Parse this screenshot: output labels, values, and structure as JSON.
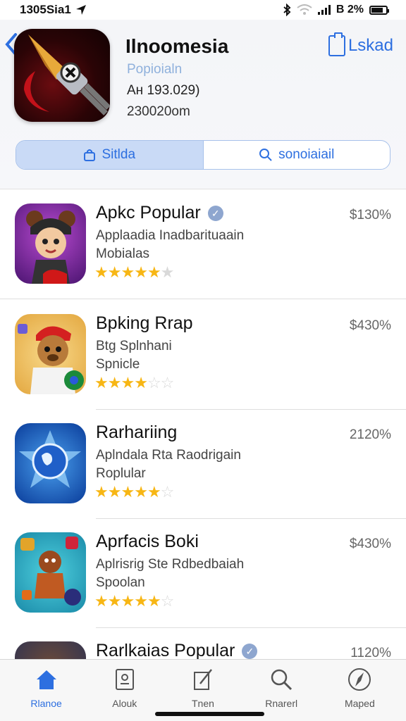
{
  "status": {
    "time": "1305Sia1",
    "battery_text": "B 2%"
  },
  "header": {
    "back_icon": "chevron-left-icon",
    "title": "Ilnoomesia",
    "subtitle": "Popioialn",
    "rank": "Ан 193.029)",
    "size": "230020om",
    "action_label": "Lskad",
    "segments": [
      {
        "label": "Sitlda",
        "icon": "bag-icon",
        "active": true
      },
      {
        "label": "sonoiaiail",
        "icon": "search-icon",
        "active": false
      }
    ]
  },
  "apps": [
    {
      "name": "Apkc Popular",
      "line1": "Applaadia Inadbarituaain",
      "line2": "Mobialas",
      "rating": 4.5,
      "price": "$130%",
      "verified": true
    },
    {
      "name": "Bpking Rrap",
      "line1": "Btg Splnhani",
      "line2": "Spnicle",
      "rating": 3.5,
      "price": "$430%",
      "verified": false
    },
    {
      "name": "Rarhariing",
      "line1": "Aplndala Rta Raodrigain",
      "line2": "Roplular",
      "rating": 3.5,
      "price": "2120%",
      "verified": false
    },
    {
      "name": "Aprfacis Boki",
      "line1": "Aplrisrig Ste Rdbedbaiah",
      "line2": "Spoolan",
      "rating": 4.5,
      "price": "$430%",
      "verified": false
    },
    {
      "name": "Rarlkaias Popular",
      "line1": "",
      "line2": "",
      "rating": 0,
      "price": "1120%",
      "verified": true
    }
  ],
  "tabs": [
    {
      "label": "Rlanoe",
      "icon": "home-icon",
      "active": true
    },
    {
      "label": "Alouk",
      "icon": "book-icon",
      "active": false
    },
    {
      "label": "Tnen",
      "icon": "edit-icon",
      "active": false
    },
    {
      "label": "Rnarerl",
      "icon": "search-icon",
      "active": false
    },
    {
      "label": "Maped",
      "icon": "compass-icon",
      "active": false
    }
  ],
  "colors": {
    "accent": "#2d6fe0",
    "star": "#f7b614"
  }
}
